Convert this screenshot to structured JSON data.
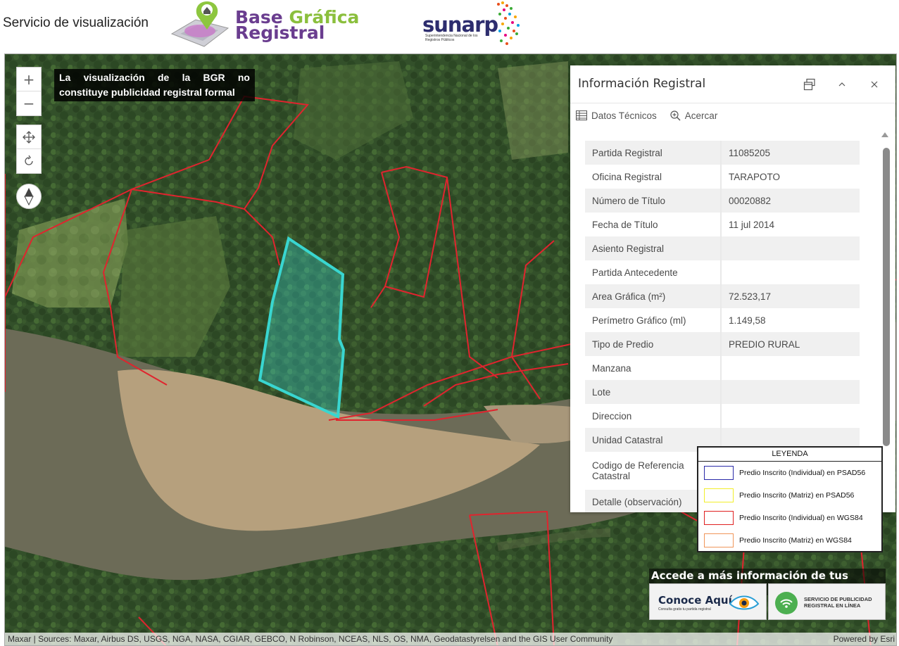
{
  "header": {
    "title": "Servicio de visualización",
    "bgr_logo_line1_a": "Base ",
    "bgr_logo_line1_b": "Gráfica",
    "bgr_logo_line2": "Registral",
    "sunarp_word": "sunarp",
    "sunarp_sub": "Superintendencia Nacional de los Registros Públicos"
  },
  "map": {
    "zoom_in": "+",
    "zoom_out": "−",
    "notice": "La visualización de la BGR no constituye publicidad registral formal",
    "attribution_left": "Maxar | Sources: Maxar, Airbus DS, USGS, NGA, NASA, CGIAR, GEBCO, N Robinson, NCEAS, NLS, OS, NMA, Geodatastyrelsen and the GIS User Community",
    "attribution_right": "Powered by Esri"
  },
  "popup": {
    "title": "Información Registral",
    "toolbar": {
      "datos_tecnicos": "Datos Técnicos",
      "acercar": "Acercar"
    },
    "rows": [
      {
        "label": "Partida Registral",
        "value": "11085205"
      },
      {
        "label": "Oficina Registral",
        "value": "TARAPOTO"
      },
      {
        "label": "Número de Título",
        "value": "00020882"
      },
      {
        "label": "Fecha de Título",
        "value": "11 jul 2014"
      },
      {
        "label": "Asiento Registral",
        "value": ""
      },
      {
        "label": "Partida Antecedente",
        "value": ""
      },
      {
        "label": "Area Gráfica (m²)",
        "value": "72.523,17"
      },
      {
        "label": "Perímetro Gráfico (ml)",
        "value": "1.149,58"
      },
      {
        "label": "Tipo de Predio",
        "value": "PREDIO RURAL"
      },
      {
        "label": "Manzana",
        "value": ""
      },
      {
        "label": "Lote",
        "value": ""
      },
      {
        "label": "Direccion",
        "value": ""
      },
      {
        "label": "Unidad Catastral",
        "value": ""
      },
      {
        "label": "Codigo de Referencia Catastral",
        "value": ""
      },
      {
        "label": "Detalle (observación)",
        "value": ""
      }
    ]
  },
  "legend": {
    "title": "LEYENDA",
    "items": [
      {
        "label": "Predio Inscrito (Individual) en PSAD56",
        "color": "#2a2aa8"
      },
      {
        "label": "Predio Inscrito (Matriz) en PSAD56",
        "color": "#f2ee2b"
      },
      {
        "label": "Predio Inscrito (Individual) en WGS84",
        "color": "#e02020"
      },
      {
        "label": "Predio Inscrito (Matriz) en WGS84",
        "color": "#f0965a"
      }
    ]
  },
  "promo": {
    "title": "Accede a más información de tus partidas",
    "conoce": "Conoce Aquí",
    "conoce_sub": "Consulta gratis tu partida registral",
    "spril_line1": "SERVICIO DE PUBLICIDAD",
    "spril_line2": "REGISTRAL EN LÍNEA"
  },
  "colors": {
    "parcel_red": "#e0242e",
    "selected_cyan": "#39d6d0",
    "forest": "#2f4a22",
    "river": "#6b6a55",
    "sand": "#b8a27f"
  }
}
